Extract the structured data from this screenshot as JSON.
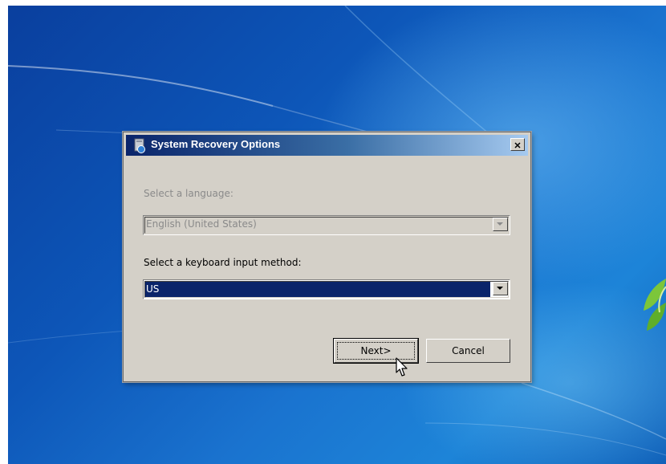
{
  "dialog": {
    "title": "System Recovery Options",
    "close_glyph": "✕",
    "language_label": "Select a language:",
    "language_value": "English (United States)",
    "keyboard_label": "Select a keyboard input method:",
    "keyboard_value": "US",
    "next_label": "Next>",
    "cancel_label": "Cancel"
  },
  "icons": {
    "title_icon": "system-recovery-icon",
    "dropdown_arrow": "chevron-down-icon",
    "cursor": "mouse-pointer-icon"
  },
  "colors": {
    "titlebar_start": "#0a246a",
    "titlebar_end": "#a6caf0",
    "selection": "#0a246a",
    "dialog_face": "#d4d0c8"
  }
}
